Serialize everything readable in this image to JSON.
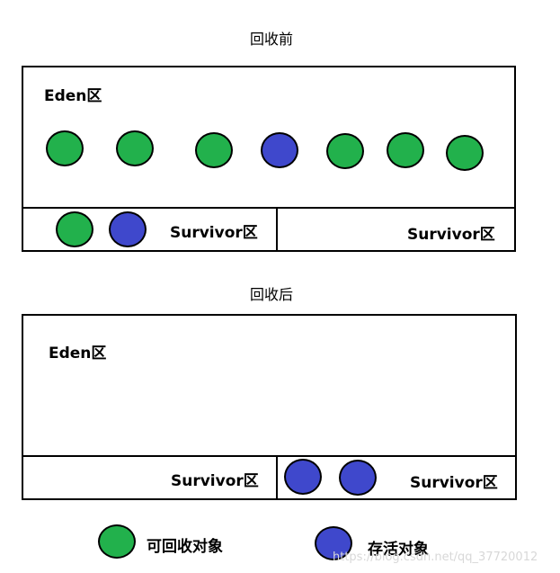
{
  "colors": {
    "recyclable": "#22b14c",
    "surviving": "#3f48cc",
    "outline": "#000000"
  },
  "before": {
    "title": "回收前",
    "eden_label": "Eden区",
    "survivor_left_label": "Survivor区",
    "survivor_right_label": "Survivor区",
    "eden_objects": [
      "recyclable",
      "recyclable",
      "recyclable",
      "surviving",
      "recyclable",
      "recyclable",
      "recyclable"
    ],
    "survivor_left_objects": [
      "recyclable",
      "surviving"
    ]
  },
  "after": {
    "title": "回收后",
    "eden_label": "Eden区",
    "survivor_left_label": "Survivor区",
    "survivor_right_label": "Survivor区",
    "survivor_right_objects": [
      "surviving",
      "surviving"
    ]
  },
  "legend": {
    "recyclable_label": "可回收对象",
    "surviving_label": "存活对象"
  },
  "watermark": "https://blog.csdn.net/qq_37720012"
}
